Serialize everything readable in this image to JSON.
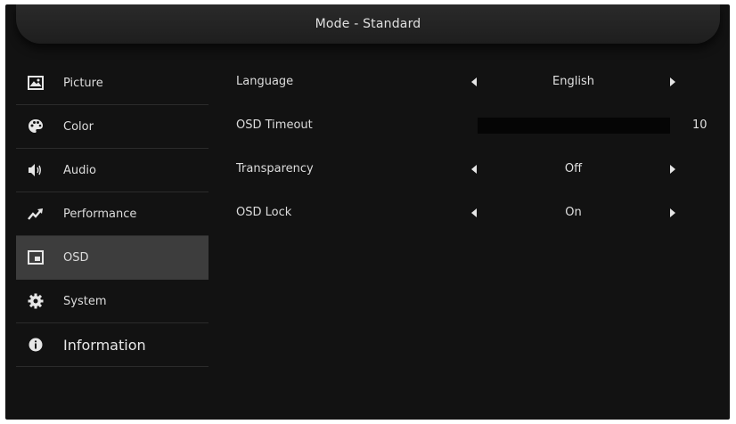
{
  "header": {
    "title": "Mode - Standard"
  },
  "sidebar": {
    "items": [
      {
        "label": "Picture",
        "icon": "picture-icon"
      },
      {
        "label": "Color",
        "icon": "palette-icon"
      },
      {
        "label": "Audio",
        "icon": "speaker-icon"
      },
      {
        "label": "Performance",
        "icon": "trend-arrow-icon"
      },
      {
        "label": "OSD",
        "icon": "osd-icon",
        "active": true
      },
      {
        "label": "System",
        "icon": "gear-icon"
      },
      {
        "label": "Information",
        "icon": "info-icon"
      }
    ]
  },
  "settings": {
    "language": {
      "label": "Language",
      "value": "English"
    },
    "osd_timeout": {
      "label": "OSD Timeout",
      "value": "10",
      "level_percent": 0
    },
    "transparency": {
      "label": "Transparency",
      "value": "Off"
    },
    "osd_lock": {
      "label": "OSD Lock",
      "value": "On"
    }
  },
  "colors": {
    "background": "#121212",
    "active_item": "#3d3d3d",
    "text": "#dcdcdc"
  }
}
